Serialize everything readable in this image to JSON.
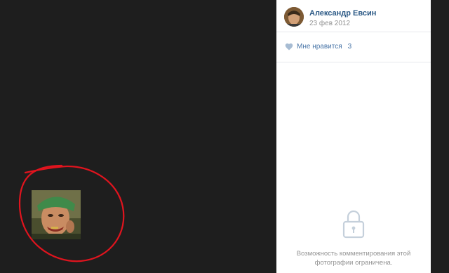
{
  "photo": {
    "icon": "photo-thumbnail",
    "annotation_color": "#e0141e"
  },
  "panel": {
    "author": "Александр Евсин",
    "date": "23 фев 2012",
    "likes": {
      "label": "Мне нравится",
      "count": "3",
      "icon": "heart-icon"
    },
    "comments": {
      "lock_icon": "lock-icon",
      "line1": "Возможность комментирования этой",
      "line2": "фотографии ограничена."
    }
  },
  "colors": {
    "background": "#1e1e1e",
    "link": "#2a5885",
    "muted": "#939393",
    "accent": "#4a76a8"
  }
}
